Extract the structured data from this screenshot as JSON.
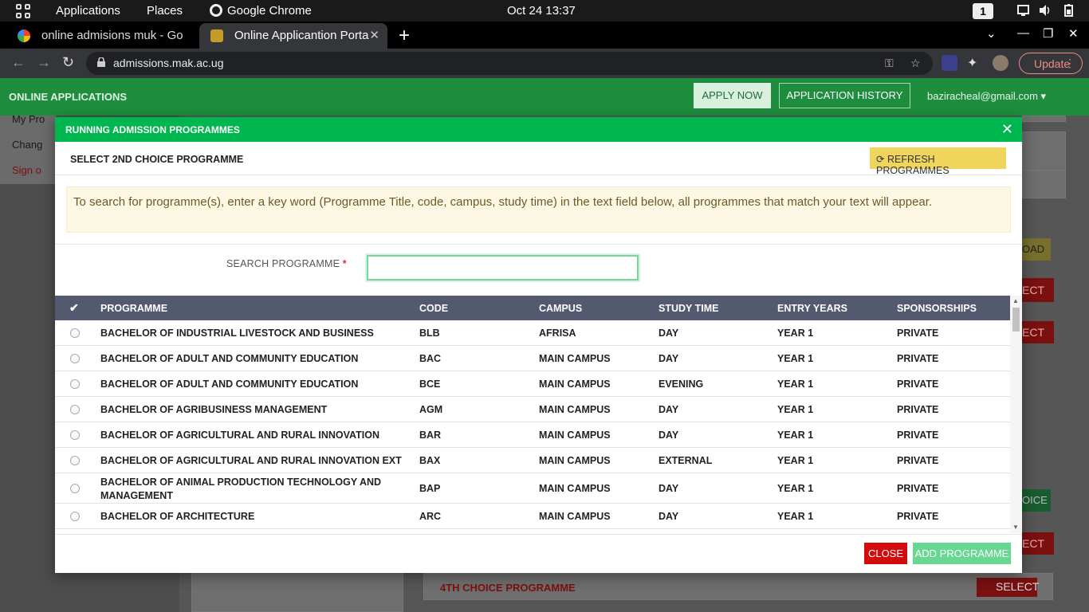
{
  "gnome": {
    "applications": "Applications",
    "places": "Places",
    "browser_name": "Google Chrome",
    "clock": "Oct 24  13:37",
    "workspace": "1"
  },
  "browser": {
    "tabs": [
      {
        "title": "online admisions muk - Go",
        "active": false
      },
      {
        "title": "Online Applicantion Porta",
        "active": true
      }
    ],
    "url": "admissions.mak.ac.ug",
    "update_label": "Update"
  },
  "header": {
    "brand": "ONLINE APPLICATIONS",
    "apply_now": "APPLY NOW",
    "application_history": "APPLICATION HISTORY",
    "user_email": "baziracheal@gmail.com"
  },
  "background": {
    "sidebar": [
      "My Pro",
      "Chang",
      "Sign o"
    ],
    "side_partials": [
      "OAD",
      "ECT",
      "ECT",
      "OICE",
      "ECT"
    ],
    "fourth_choice": "4TH CHOICE PROGRAMME",
    "select": "SELECT"
  },
  "modal": {
    "title": "RUNNING ADMISSION PROGRAMMES",
    "subtitle": "SELECT 2ND CHOICE PROGRAMME",
    "refresh": "REFRESH PROGRAMMES",
    "info": "To search for programme(s), enter a key word (Programme Title, code, campus, study time) in the text field below, all programmes that match your text will appear.",
    "search_label": "SEARCH PROGRAMME",
    "search_value": "",
    "columns": [
      "PROGRAMME",
      "CODE",
      "CAMPUS",
      "STUDY TIME",
      "ENTRY YEARS",
      "SPONSORSHIPS"
    ],
    "rows": [
      {
        "programme": "BACHELOR OF INDUSTRIAL LIVESTOCK AND BUSINESS",
        "code": "BLB",
        "campus": "AFRISA",
        "study_time": "DAY",
        "entry_years": "YEAR 1",
        "sponsorship": "PRIVATE"
      },
      {
        "programme": "BACHELOR OF ADULT AND COMMUNITY EDUCATION",
        "code": "BAC",
        "campus": "MAIN CAMPUS",
        "study_time": "DAY",
        "entry_years": "YEAR 1",
        "sponsorship": "PRIVATE"
      },
      {
        "programme": "BACHELOR OF ADULT AND COMMUNITY EDUCATION",
        "code": "BCE",
        "campus": "MAIN CAMPUS",
        "study_time": "EVENING",
        "entry_years": "YEAR 1",
        "sponsorship": "PRIVATE"
      },
      {
        "programme": "BACHELOR OF AGRIBUSINESS MANAGEMENT",
        "code": "AGM",
        "campus": "MAIN CAMPUS",
        "study_time": "DAY",
        "entry_years": "YEAR 1",
        "sponsorship": "PRIVATE"
      },
      {
        "programme": "BACHELOR OF AGRICULTURAL AND RURAL INNOVATION",
        "code": "BAR",
        "campus": "MAIN CAMPUS",
        "study_time": "DAY",
        "entry_years": "YEAR 1",
        "sponsorship": "PRIVATE"
      },
      {
        "programme": "BACHELOR OF AGRICULTURAL AND RURAL INNOVATION EXT",
        "code": "BAX",
        "campus": "MAIN CAMPUS",
        "study_time": "EXTERNAL",
        "entry_years": "YEAR 1",
        "sponsorship": "PRIVATE"
      },
      {
        "programme": "BACHELOR OF ANIMAL PRODUCTION TECHNOLOGY AND MANAGEMENT",
        "code": "BAP",
        "campus": "MAIN CAMPUS",
        "study_time": "DAY",
        "entry_years": "YEAR 1",
        "sponsorship": "PRIVATE"
      },
      {
        "programme": "BACHELOR OF ARCHITECTURE",
        "code": "ARC",
        "campus": "MAIN CAMPUS",
        "study_time": "DAY",
        "entry_years": "YEAR 1",
        "sponsorship": "PRIVATE"
      }
    ],
    "close": "CLOSE",
    "add": "ADD PROGRAMME"
  },
  "colors": {
    "header_green": "#1e8e3e",
    "modal_green": "#00b64f",
    "table_head": "#535a70",
    "close_red": "#d40b0b",
    "add_green": "#67d792",
    "refresh_yellow": "#f0d55c"
  }
}
